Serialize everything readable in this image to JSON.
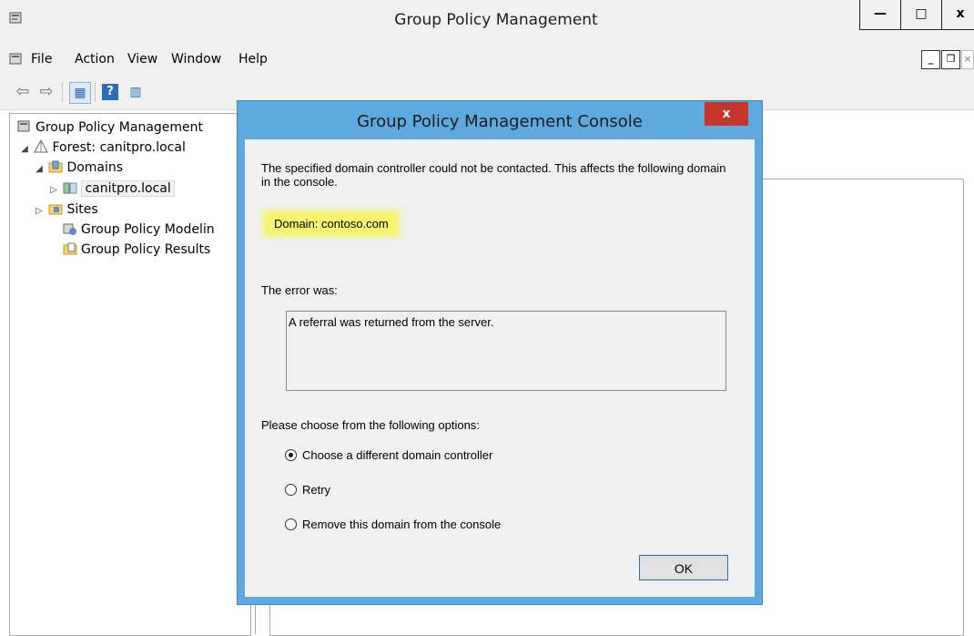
{
  "window": {
    "title": "Group Policy Management",
    "controls": {
      "minimize": "—",
      "maximize": "□",
      "close": "x"
    }
  },
  "menu": {
    "items": [
      "File",
      "Action",
      "View",
      "Window",
      "Help"
    ],
    "mdi": {
      "minimize": "_",
      "restore": "❐",
      "close": "×"
    }
  },
  "toolbar": {
    "back": "⇦",
    "forward": "⇨",
    "show_hide": "▦",
    "help": "?",
    "action_pane": "▥"
  },
  "tree": {
    "root": "Group Policy Management",
    "forest": "Forest: canitpro.local",
    "domains": "Domains",
    "domain_item": "canitpro.local",
    "sites": "Sites",
    "modeling": "Group Policy Modelin",
    "results": "Group Policy Results"
  },
  "dialog": {
    "title": "Group Policy Management Console",
    "close": "x",
    "message": "The specified domain controller could not be contacted. This affects the following domain in the console.",
    "domain": "Domain: contoso.com",
    "error_label": "The error was:",
    "error_text": "A referral was returned from the server.",
    "options_label": "Please choose from the following options:",
    "options": [
      {
        "label": "Choose a different domain controller",
        "checked": true
      },
      {
        "label": "Retry",
        "checked": false
      },
      {
        "label": "Remove this domain from the console",
        "checked": false
      }
    ],
    "ok": "OK"
  },
  "colors": {
    "dialog_frame": "#5ea9dd",
    "close_red": "#c6362b",
    "highlight": "#f6f36c"
  }
}
